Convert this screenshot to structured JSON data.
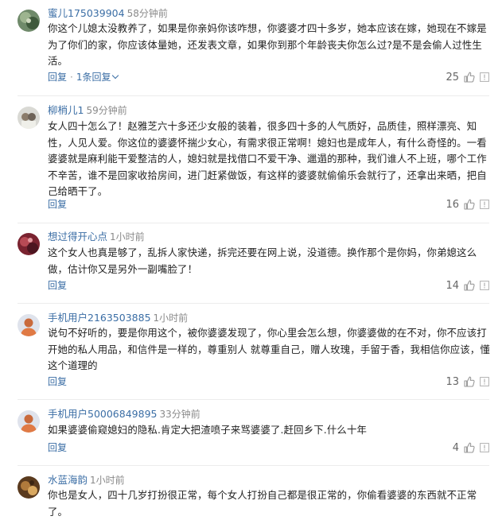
{
  "labels": {
    "reply": "回复",
    "replies_separator": "·"
  },
  "comments": [
    {
      "user": "蜜儿175039904",
      "time": "58分钟前",
      "text": "你这个儿媳太没教养了，如果是你亲妈你该咋想，你婆婆才四十多岁，她本应该在嫁，她现在不嫁是为了你们的家，你应该体量她，还发表文章，如果你到那个年龄丧夫你怎么过?是不是会偷人过性生活。",
      "replies_count_label": "1条回复",
      "likes": "25"
    },
    {
      "user": "柳梢儿1",
      "time": "59分钟前",
      "text": "女人四十怎么了！赵雅芝六十多还少女般的装着，很多四十多的人气质好，品质佳，照样漂亮、知性，人见人爱。你这位的婆婆怀揣少女心，有需求很正常啊！媳妇也是成年人，有什么奇怪的。一看婆婆就是麻利能干爱整洁的人，媳妇就是找借口不爱干净、邋遢的那种，我们谁人不上班，哪个工作不辛苦，谁不是回家收拾房间，进门赶紧做饭，有这样的婆婆就偷偷乐会就行了，还拿出来晒，把自己给晒干了。",
      "likes": "16"
    },
    {
      "user": "想过得开心点",
      "time": "1小时前",
      "text": "这个女人也真是够了，乱拆人家快递，拆完还要在网上说，没道德。换作那个是你妈，你弟媳这么做，估计你又是另外一副嘴脸了！",
      "likes": "14"
    },
    {
      "user": "手机用户2163503885",
      "time": "1小时前",
      "text": "说句不好听的，要是你用这个，被你婆婆发现了，你心里会怎么想，你婆婆做的在不对，你不应该打开她的私人用品，和信件是一样的，尊重别人 就尊重自己，赠人玫瑰，手留于香，我相信你应该，懂这个道理的",
      "likes": "13"
    },
    {
      "user": "手机用户50006849895",
      "time": "33分钟前",
      "text": "如果婆婆偷窥媳妇的隐私.肯定大把渣喷子来骂婆婆了.赶回乡下.什么十年",
      "likes": "4"
    },
    {
      "user": "水蓝海韵",
      "time": "1小时前",
      "text": "你也是女人，四十几岁打扮很正常，每个女人打扮自己都是很正常的，你偷看婆婆的东西就不正常了。"
    }
  ]
}
